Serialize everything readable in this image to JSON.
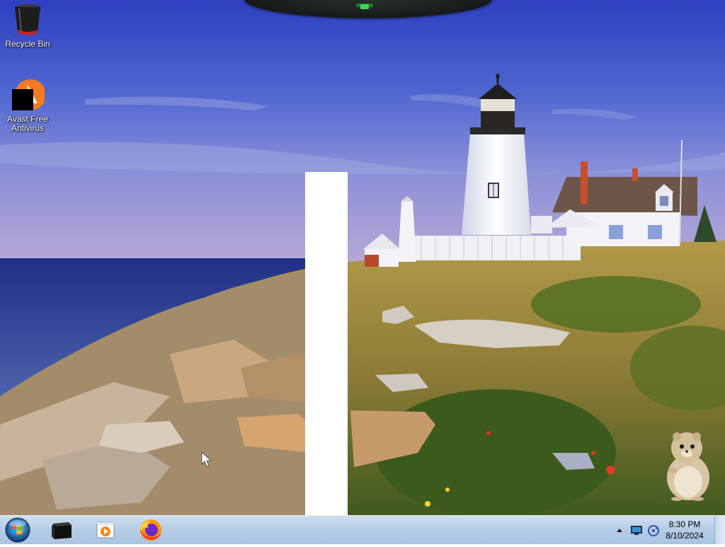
{
  "desktop": {
    "icons": [
      {
        "label": "Recycle Bin",
        "icon": "recycle-bin-icon"
      },
      {
        "label": "Avast Free Antivirus",
        "icon": "avast-icon"
      }
    ]
  },
  "taskbar": {
    "start": {
      "icon": "windows-orb-icon"
    },
    "pinned": [
      {
        "icon": "terminal-icon"
      },
      {
        "icon": "media-player-icon"
      },
      {
        "icon": "firefox-icon"
      }
    ],
    "tray": {
      "icons": [
        "show-hidden-icons-arrow",
        "network-icon",
        "sync-icon"
      ],
      "time": "8:30 PM",
      "date": "8/10/2024"
    }
  },
  "colors": {
    "taskbar": "#b5cde6",
    "sky": "#3c4fc4",
    "sea": "#2b3e8e",
    "grass": "#7a7a2c"
  }
}
